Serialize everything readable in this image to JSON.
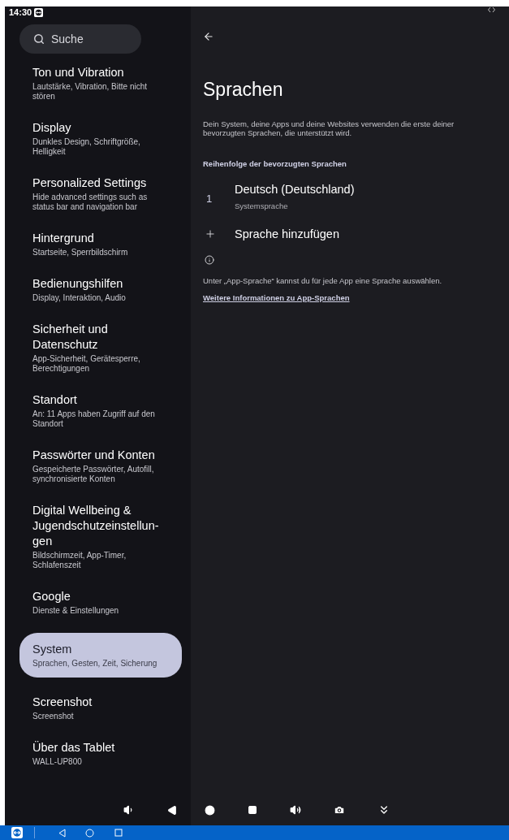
{
  "status_bar": {
    "time": "14:30"
  },
  "sidebar": {
    "search": {
      "placeholder": "Suche"
    },
    "items": [
      {
        "title": "Ton und Vibration",
        "subtitle": "Lautstärke, Vibration, Bitte nicht stören",
        "selected": false
      },
      {
        "title": "Display",
        "subtitle": "Dunkles Design, Schriftgröße, Helligkeit",
        "selected": false
      },
      {
        "title": "Personalized Settings",
        "subtitle": "Hide advanced settings such as status bar and navigation bar",
        "selected": false
      },
      {
        "title": "Hintergrund",
        "subtitle": "Startseite, Sperrbildschirm",
        "selected": false
      },
      {
        "title": "Bedienungshilfen",
        "subtitle": "Display, Interaktion, Audio",
        "selected": false
      },
      {
        "title": "Sicherheit und Datenschutz",
        "subtitle": "App-Sicherheit, Gerätesperre, Berechtigungen",
        "selected": false
      },
      {
        "title": "Standort",
        "subtitle": "An: 11 Apps haben Zugriff auf den Standort",
        "selected": false
      },
      {
        "title": "Passwörter und Konten",
        "subtitle": "Gespeicherte Passwörter, Autofill, synchronisierte Konten",
        "selected": false
      },
      {
        "title": "Digital Wellbeing & Jugendschutzeinstellun-gen",
        "subtitle": "Bildschirmzeit, App-Timer, Schlafenszeit",
        "selected": false
      },
      {
        "title": "Google",
        "subtitle": "Dienste & Einstellungen",
        "selected": false
      },
      {
        "title": "System",
        "subtitle": "Sprachen, Gesten, Zeit, Sicherung",
        "selected": true
      },
      {
        "title": "Screenshot",
        "subtitle": "Screenshot",
        "selected": false
      },
      {
        "title": "Über das Tablet",
        "subtitle": "WALL-UP800",
        "selected": false
      }
    ]
  },
  "page": {
    "title": "Sprachen",
    "description": "Dein System, deine Apps und deine Websites verwenden die erste deiner bevorzugten Sprachen, die unterstützt wird.",
    "section_header": "Reihenfolge der bevorzugten Sprachen",
    "languages": [
      {
        "number": "1",
        "name": "Deutsch (Deutschland)",
        "subtitle": "Systemsprache"
      }
    ],
    "add_language": "Sprache hinzufügen",
    "info_text": "Unter „App-Sprache“ kannst du für jede App eine Sprache auswählen.",
    "info_link": "Weitere Informationen zu App-Sprachen"
  }
}
